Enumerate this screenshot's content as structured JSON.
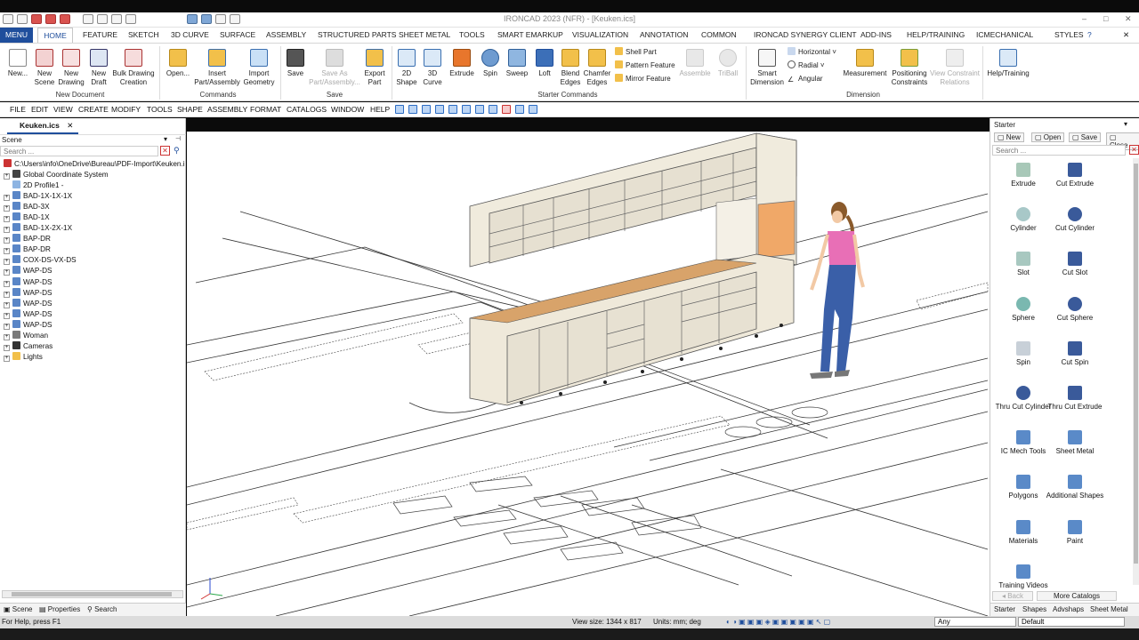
{
  "window": {
    "title": "IRONCAD 2023 (NFR) - [Keuken.ics]",
    "controls": [
      "–",
      "□",
      "✕"
    ]
  },
  "tabs": [
    "MENU",
    "HOME",
    "FEATURE",
    "SKETCH",
    "3D CURVE",
    "SURFACE",
    "ASSEMBLY",
    "STRUCTURED PARTS",
    "SHEET METAL",
    "TOOLS",
    "SMART EMARKUP",
    "VISUALIZATION",
    "ANNOTATION",
    "COMMON",
    "IRONCAD SYNERGY CLIENT",
    "ADD-INS",
    "HELP/TRAINING",
    "ICMECHANICAL"
  ],
  "styles_label": "STYLES",
  "ribbon": {
    "new_document": {
      "label": "New Document",
      "buttons": [
        "New...",
        "New Scene",
        "New Drawing",
        "New Draft",
        "Bulk Drawing Creation"
      ]
    },
    "commands": {
      "label": "Commands",
      "buttons": [
        "Open...",
        "Insert Part/Assembly",
        "Import Geometry"
      ]
    },
    "save": {
      "label": "Save",
      "buttons": [
        "Save",
        "Save As Part/Assembly...",
        "Export Part"
      ]
    },
    "starter": {
      "label": "Starter Commands",
      "buttons": [
        "2D Shape",
        "3D Curve",
        "Extrude",
        "Spin",
        "Sweep",
        "Loft",
        "Blend Edges",
        "Chamfer Edges"
      ],
      "small": [
        "Shell Part",
        "Pattern Feature",
        "Mirror Feature"
      ],
      "disabled": [
        "Assemble",
        "TriBall"
      ]
    },
    "dimension": {
      "label": "Dimension",
      "buttons": [
        "Smart Dimension",
        "Measurement",
        "Positioning Constraints",
        "View Constraint Relations"
      ],
      "small": [
        "Horizontal",
        "Radial",
        "Angular"
      ]
    },
    "help": {
      "buttons": [
        "Help/Training"
      ]
    }
  },
  "menubar": [
    "FILE",
    "EDIT",
    "VIEW",
    "CREATE",
    "MODIFY",
    "TOOLS",
    "SHAPE",
    "ASSEMBLY",
    "FORMAT",
    "CATALOGS",
    "WINDOW",
    "HELP"
  ],
  "document_tab": "Keuken.ics",
  "scene_panel": {
    "title": "Scene",
    "search_placeholder": "Search ...",
    "root": "C:\\Users\\info\\OneDrive\\Bureau\\PDF-Import\\Keuken.i",
    "items": [
      "Global Coordinate System",
      "2D Profile1 -",
      "BAD-1X-1X-1X",
      "BAD-3X",
      "BAD-1X",
      "BAD-1X-2X-1X",
      "BAP-DR",
      "BAP-DR",
      "COX-DS-VX-DS",
      "WAP-DS",
      "WAP-DS",
      "WAP-DS",
      "WAP-DS",
      "WAP-DS",
      "WAP-DS",
      "Woman",
      "Cameras",
      "Lights"
    ],
    "bottom_tabs": [
      "Scene",
      "Properties",
      "Search"
    ]
  },
  "catalog": {
    "title": "Starter",
    "buttons": [
      "New",
      "Open",
      "Save",
      "Close"
    ],
    "search_placeholder": "Search ...",
    "items": [
      "Extrude",
      "Cut Extrude",
      "Cylinder",
      "Cut Cylinder",
      "Slot",
      "Cut Slot",
      "Sphere",
      "Cut Sphere",
      "Spin",
      "Cut Spin",
      "Thru Cut Cylinder",
      "Thru Cut Extrude",
      "IC Mech Tools",
      "Sheet Metal",
      "Polygons",
      "Additional Shapes",
      "Materials",
      "Paint",
      "Training Videos"
    ],
    "nav": [
      "Back",
      "More Catalogs"
    ],
    "bottom_tabs": [
      "Starter",
      "Shapes",
      "Advshaps",
      "Sheet Metal"
    ]
  },
  "status": {
    "help": "For Help, press F1",
    "view_size": "View size: 1344 x 817",
    "units": "Units:  mm; deg",
    "filter_value": "Any",
    "style_value": "Default"
  },
  "colors": {
    "accent": "#1f4e9c",
    "cabinet": "#efe9da",
    "orange_panel": "#f0a868",
    "shirt": "#e86fb6",
    "jeans": "#3a5fa8"
  }
}
